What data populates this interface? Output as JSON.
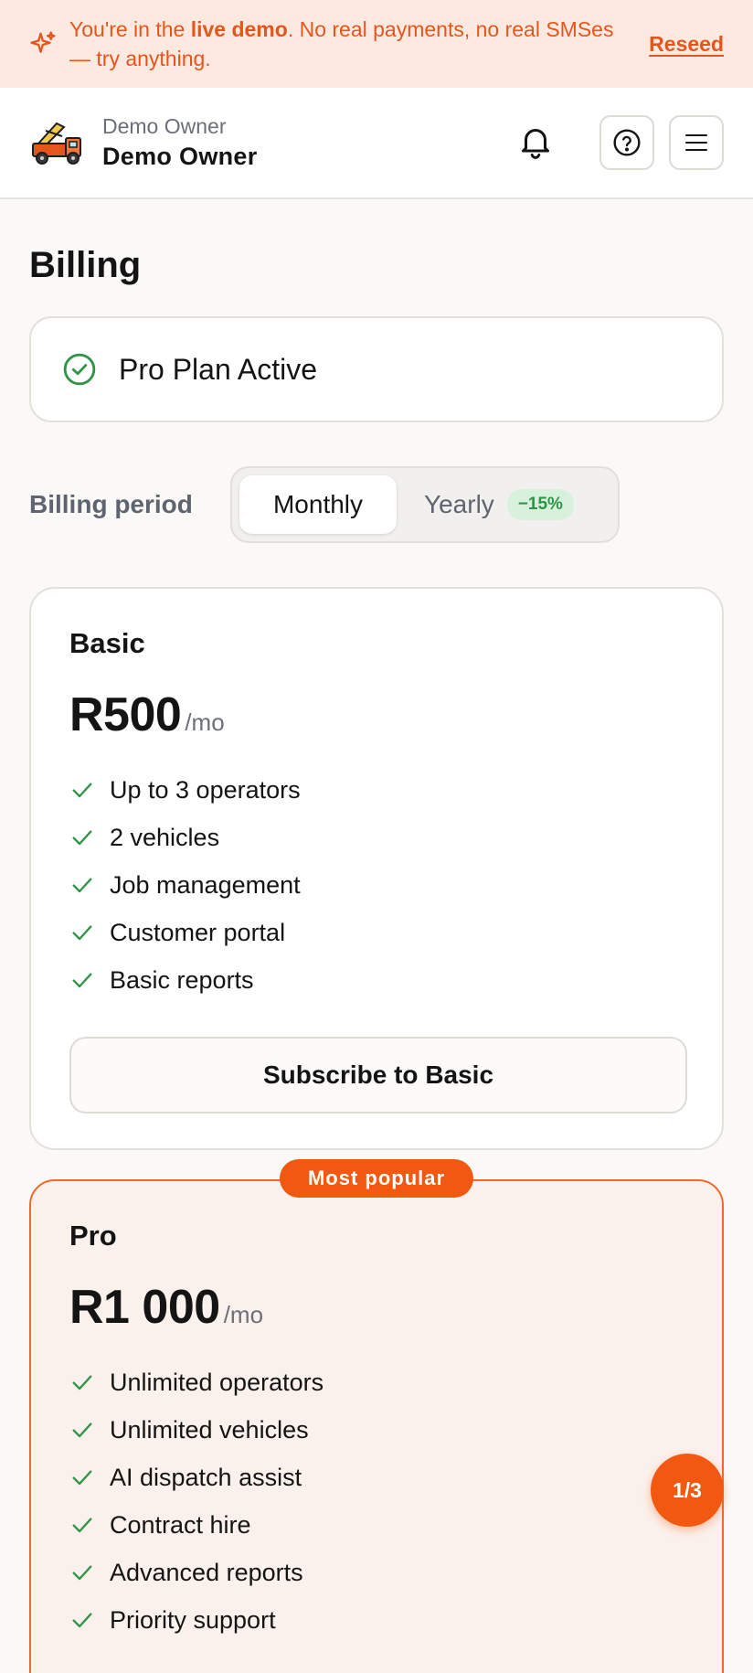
{
  "banner": {
    "prefix": "You're in the ",
    "highlight": "live demo",
    "suffix": ". No real payments, no real SMSes — try anything.",
    "action": "Reseed"
  },
  "header": {
    "org_name": "Demo Owner",
    "user_name": "Demo Owner",
    "icons": [
      "notification-bell-icon",
      "help-icon",
      "menu-icon"
    ]
  },
  "page": {
    "title": "Billing",
    "status": "Pro Plan Active"
  },
  "billing_period": {
    "label": "Billing period",
    "options": {
      "monthly": "Monthly",
      "yearly": "Yearly",
      "yearly_discount": "−15%"
    },
    "selected": "Monthly"
  },
  "plans": {
    "basic": {
      "name": "Basic",
      "price": "R500",
      "period": "/mo",
      "features": [
        "Up to 3 operators",
        "2 vehicles",
        "Job management",
        "Customer portal",
        "Basic reports"
      ],
      "cta": "Subscribe to Basic"
    },
    "pro": {
      "badge": "Most popular",
      "name": "Pro",
      "price": "R1 000",
      "period": "/mo",
      "features": [
        "Unlimited operators",
        "Unlimited vehicles",
        "AI dispatch assist",
        "Contract hire",
        "Advanced reports",
        "Priority support"
      ]
    }
  },
  "pager": "1/3",
  "colors": {
    "accent": "#f2580f",
    "banner_bg": "#fde9e0",
    "success": "#2f9446"
  }
}
